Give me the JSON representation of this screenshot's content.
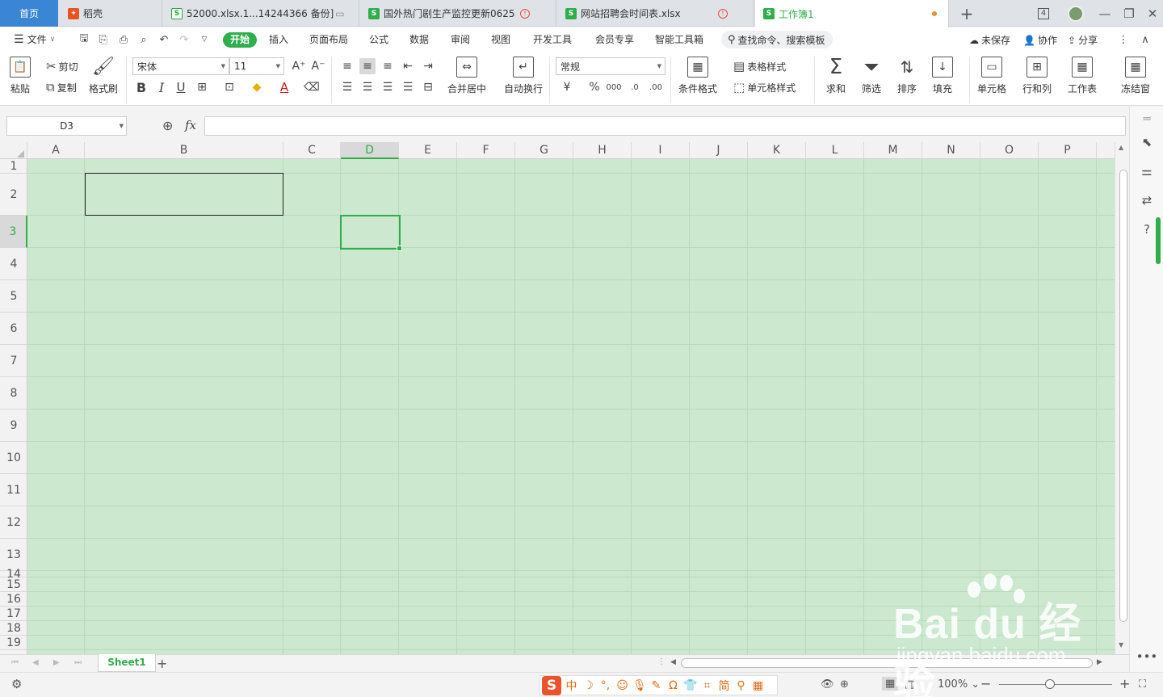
{
  "tabs": [
    {
      "label": "首页",
      "kind": "home"
    },
    {
      "label": "稻壳",
      "kind": "docer"
    },
    {
      "label": "52000.xlsx.1...14244366 备份]",
      "kind": "sheet"
    },
    {
      "label": "国外热门剧生产监控更新0625",
      "kind": "sheet"
    },
    {
      "label": "网站招聘会时间表.xlsx",
      "kind": "sheet"
    },
    {
      "label": "工作簿1",
      "kind": "sheet-active"
    }
  ],
  "window": {
    "tab_count": "4",
    "add_tab": "+"
  },
  "menu": {
    "file": "文件",
    "items": [
      "开始",
      "插入",
      "页面布局",
      "公式",
      "数据",
      "审阅",
      "视图",
      "开发工具",
      "会员专享",
      "智能工具箱"
    ],
    "search_placeholder": "查找命令、搜索模板",
    "unsaved": "未保存",
    "collab": "协作",
    "share": "分享"
  },
  "ribbon": {
    "paste": "粘贴",
    "cut": "剪切",
    "copy": "复制",
    "format_painter": "格式刷",
    "font_name": "宋体",
    "font_size": "11",
    "merge_center": "合并居中",
    "wrap_text": "自动换行",
    "number_format": "常规",
    "conditional_format": "条件格式",
    "table_style": "表格样式",
    "cell_style": "单元格样式",
    "sum": "求和",
    "filter": "筛选",
    "sort": "排序",
    "fill": "填充",
    "cell": "单元格",
    "row_col": "行和列",
    "worksheet": "工作表",
    "freeze": "冻结窗"
  },
  "formula_bar": {
    "cell_ref": "D3",
    "fx": "fx",
    "value": ""
  },
  "grid": {
    "columns": [
      "A",
      "B",
      "C",
      "D",
      "E",
      "F",
      "G",
      "H",
      "I",
      "J",
      "K",
      "L",
      "M",
      "N",
      "O",
      "P"
    ],
    "rows": [
      "1",
      "2",
      "3",
      "4",
      "5",
      "6",
      "7",
      "8",
      "9",
      "10",
      "11",
      "12",
      "13",
      "14",
      "15",
      "16",
      "17",
      "18",
      "19"
    ],
    "selected_column": "D",
    "selected_row": "3",
    "cell_color": "#cce8cf"
  },
  "sheets": {
    "active": "Sheet1",
    "add": "+"
  },
  "status": {
    "zoom": "100%",
    "zoom_fraction": 0.45
  },
  "watermark": {
    "big": "Bai du 经验",
    "small": "jingyan.baidu.com"
  },
  "colors": {
    "accent": "#2fae4b",
    "home_tab": "#3b86d4"
  }
}
